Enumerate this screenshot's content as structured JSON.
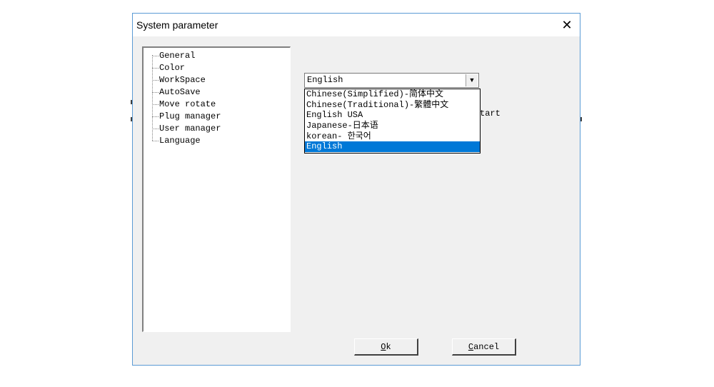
{
  "window": {
    "title": "System parameter",
    "close_glyph": "✕"
  },
  "tree": {
    "items": [
      {
        "label": "General"
      },
      {
        "label": "Color"
      },
      {
        "label": "WorkSpace"
      },
      {
        "label": "AutoSave"
      },
      {
        "label": "Move rotate"
      },
      {
        "label": "Plug manager"
      },
      {
        "label": "User manager"
      },
      {
        "label": "Language"
      }
    ]
  },
  "language": {
    "selected_value": "English",
    "dropdown_arrow": "▼",
    "options": [
      {
        "label": "Chinese(Simplified)-简体中文"
      },
      {
        "label": "Chinese(Traditional)-繁體中文"
      },
      {
        "label": "English USA"
      },
      {
        "label": "Japanese-日本语"
      },
      {
        "label": "korean- 한국어"
      },
      {
        "label": "English"
      }
    ],
    "highlighted_index": 5,
    "partially_hidden_text": "tart"
  },
  "buttons": {
    "ok": {
      "mnemonic": "O",
      "rest": "k"
    },
    "cancel": {
      "mnemonic": "C",
      "rest": "ancel"
    }
  },
  "colors": {
    "dialog_bg": "#f0f0f0",
    "border_accent": "#5b9bd5",
    "selection": "#0078d7"
  }
}
